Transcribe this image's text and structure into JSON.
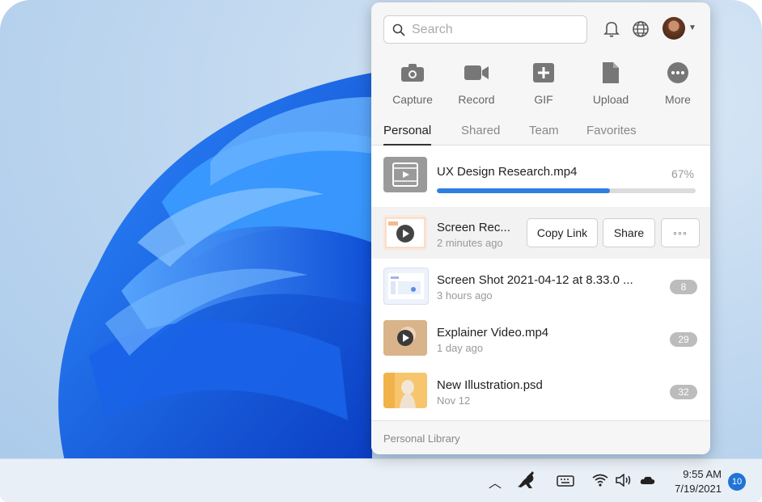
{
  "search": {
    "placeholder": "Search"
  },
  "actions": [
    {
      "label": "Capture",
      "icon": "camera-icon"
    },
    {
      "label": "Record",
      "icon": "video-camera-icon"
    },
    {
      "label": "GIF",
      "icon": "gif-plus-icon"
    },
    {
      "label": "Upload",
      "icon": "document-upload-icon"
    },
    {
      "label": "More",
      "icon": "more-dots-icon"
    }
  ],
  "tabs": [
    "Personal",
    "Shared",
    "Team",
    "Favorites"
  ],
  "active_tab": "Personal",
  "files": [
    {
      "name": "UX Design Research.mp4",
      "progress_label": "67%",
      "progress": 0.67
    },
    {
      "name": "Screen Rec...",
      "time": "2 minutes ago",
      "buttons": {
        "copy_link": "Copy Link",
        "share": "Share",
        "more": "◦◦◦"
      }
    },
    {
      "name": "Screen Shot 2021-04-12 at 8.33.0 ...",
      "time": "3 hours ago",
      "count": "8"
    },
    {
      "name": "Explainer Video.mp4",
      "time": "1 day ago",
      "count": "29"
    },
    {
      "name": "New Illustration.psd",
      "time": "Nov 12",
      "count": "32"
    }
  ],
  "footer": {
    "label": "Personal Library"
  },
  "taskbar": {
    "time": "9:55 AM",
    "date": "7/19/2021",
    "notifications": "10"
  },
  "colors": {
    "accent": "#2f7fe0",
    "badge": "#1f74d6"
  }
}
